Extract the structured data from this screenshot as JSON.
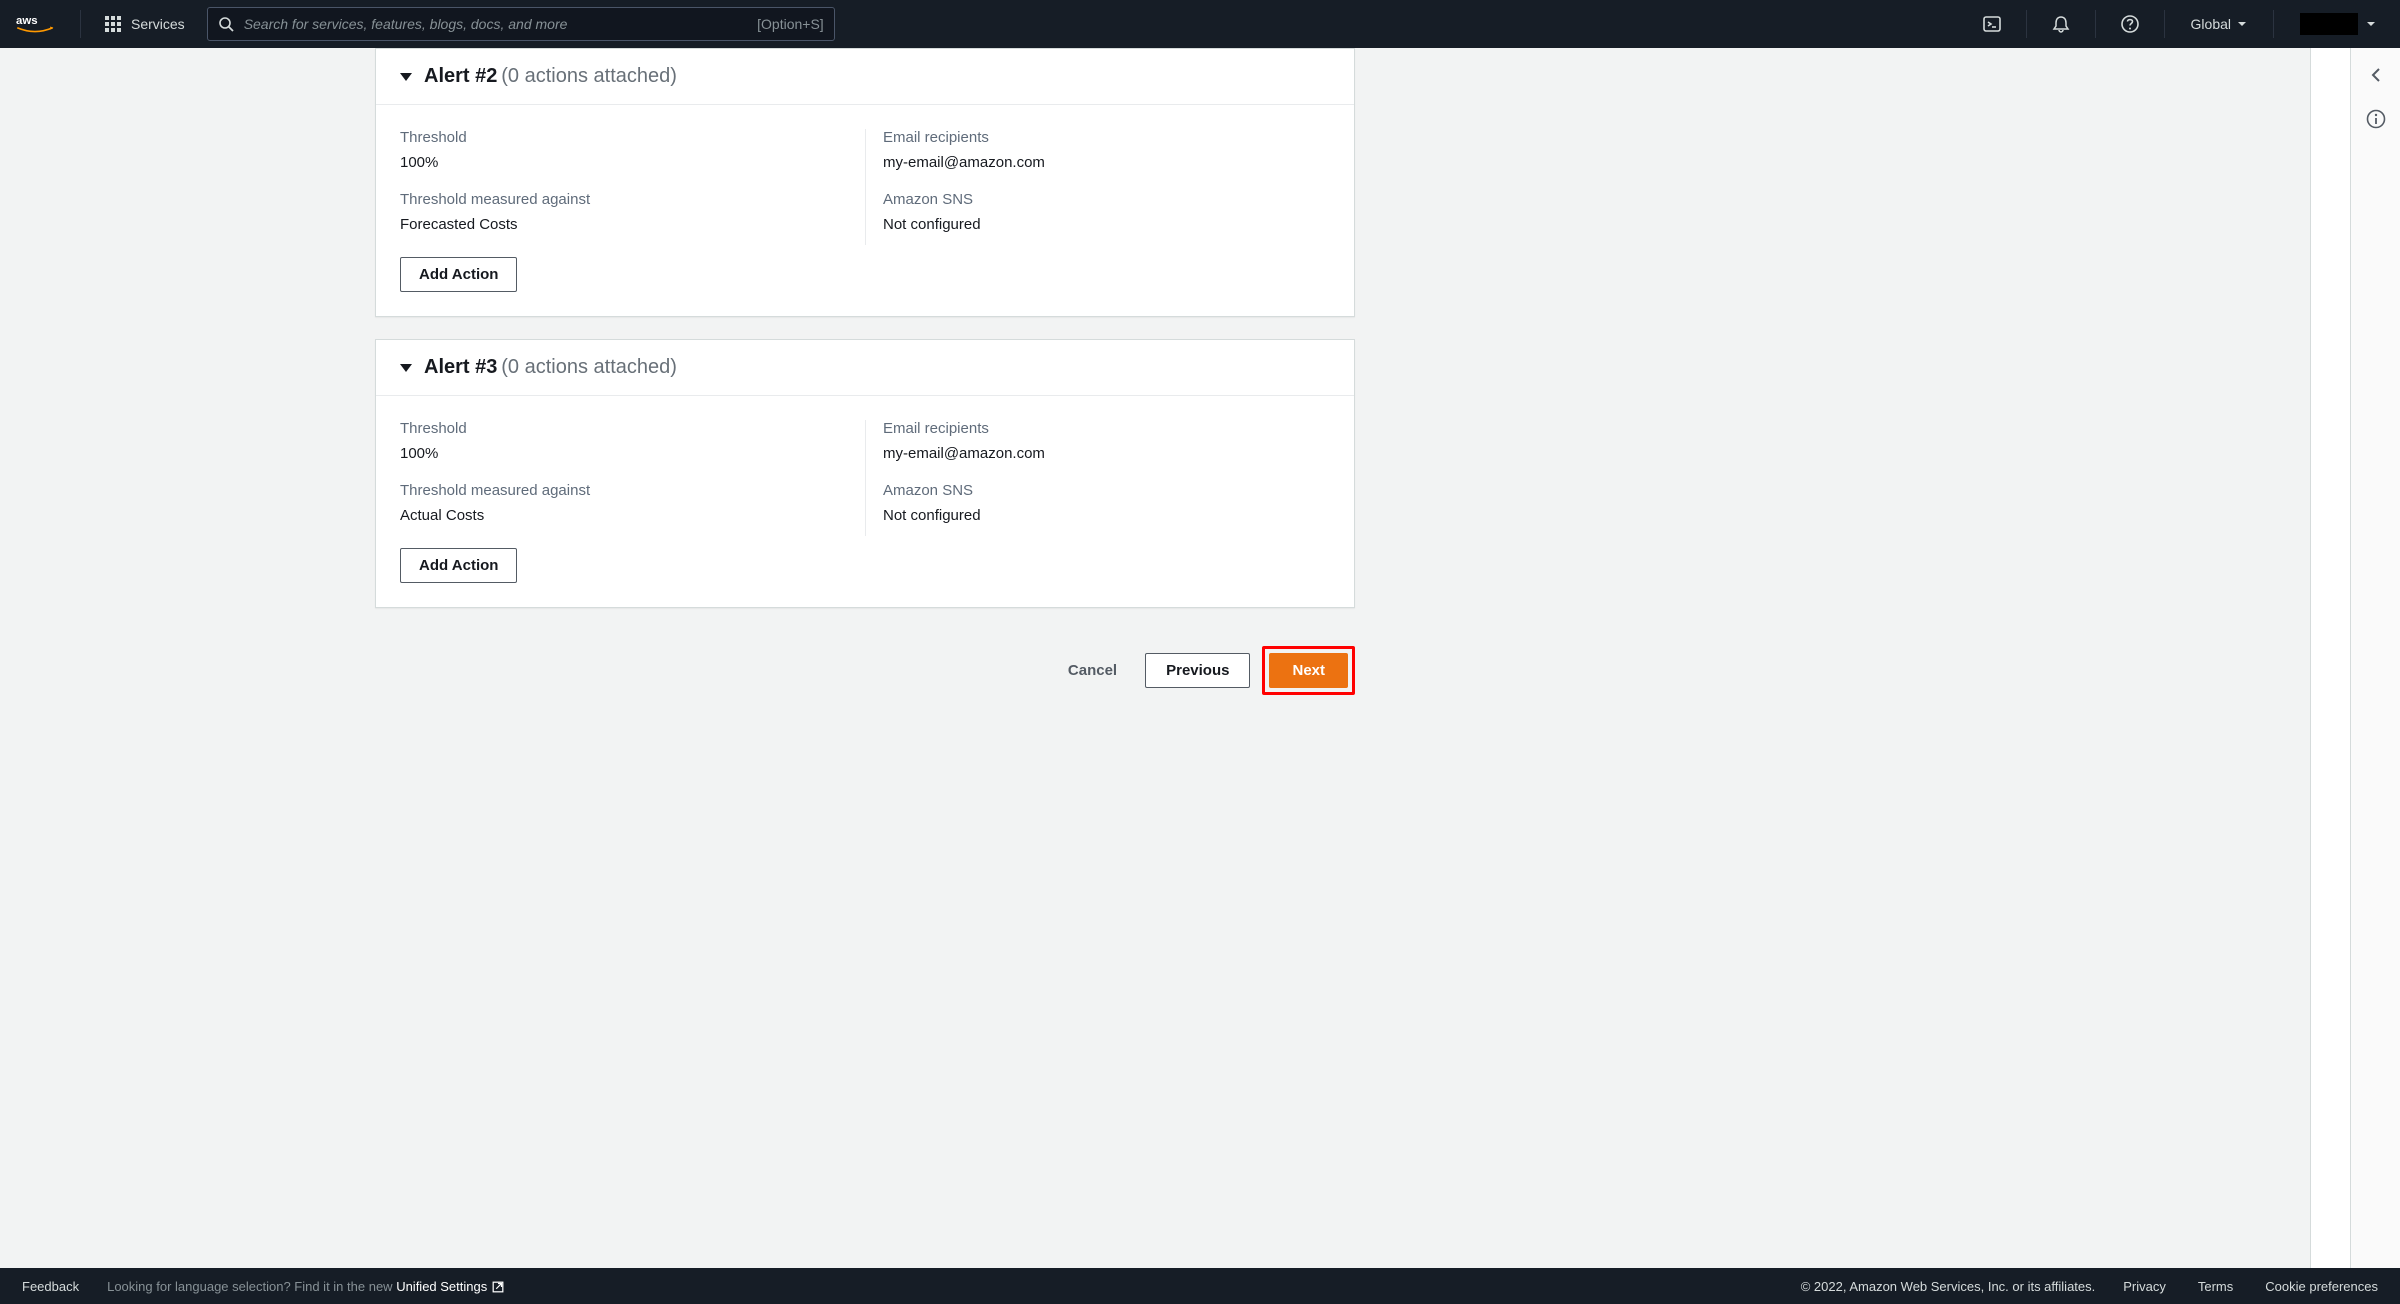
{
  "nav": {
    "services_label": "Services",
    "search_placeholder": "Search for services, features, blogs, docs, and more",
    "search_shortcut": "[Option+S]",
    "region_label": "Global"
  },
  "alerts": [
    {
      "title": "Alert #2",
      "subtitle": "(0 actions attached)",
      "threshold_label": "Threshold",
      "threshold_value": "100%",
      "measure_label": "Threshold measured against",
      "measure_value": "Forecasted Costs",
      "email_label": "Email recipients",
      "email_value": "my-email@amazon.com",
      "sns_label": "Amazon SNS",
      "sns_value": "Not configured",
      "add_action_label": "Add Action"
    },
    {
      "title": "Alert #3",
      "subtitle": "(0 actions attached)",
      "threshold_label": "Threshold",
      "threshold_value": "100%",
      "measure_label": "Threshold measured against",
      "measure_value": "Actual Costs",
      "email_label": "Email recipients",
      "email_value": "my-email@amazon.com",
      "sns_label": "Amazon SNS",
      "sns_value": "Not configured",
      "add_action_label": "Add Action"
    }
  ],
  "wizard": {
    "cancel": "Cancel",
    "previous": "Previous",
    "next": "Next"
  },
  "footer": {
    "feedback": "Feedback",
    "lang_hint": "Looking for language selection? Find it in the new ",
    "settings_link": "Unified Settings",
    "copyright": "© 2022, Amazon Web Services, Inc. or its affiliates.",
    "privacy": "Privacy",
    "terms": "Terms",
    "cookies": "Cookie preferences"
  }
}
